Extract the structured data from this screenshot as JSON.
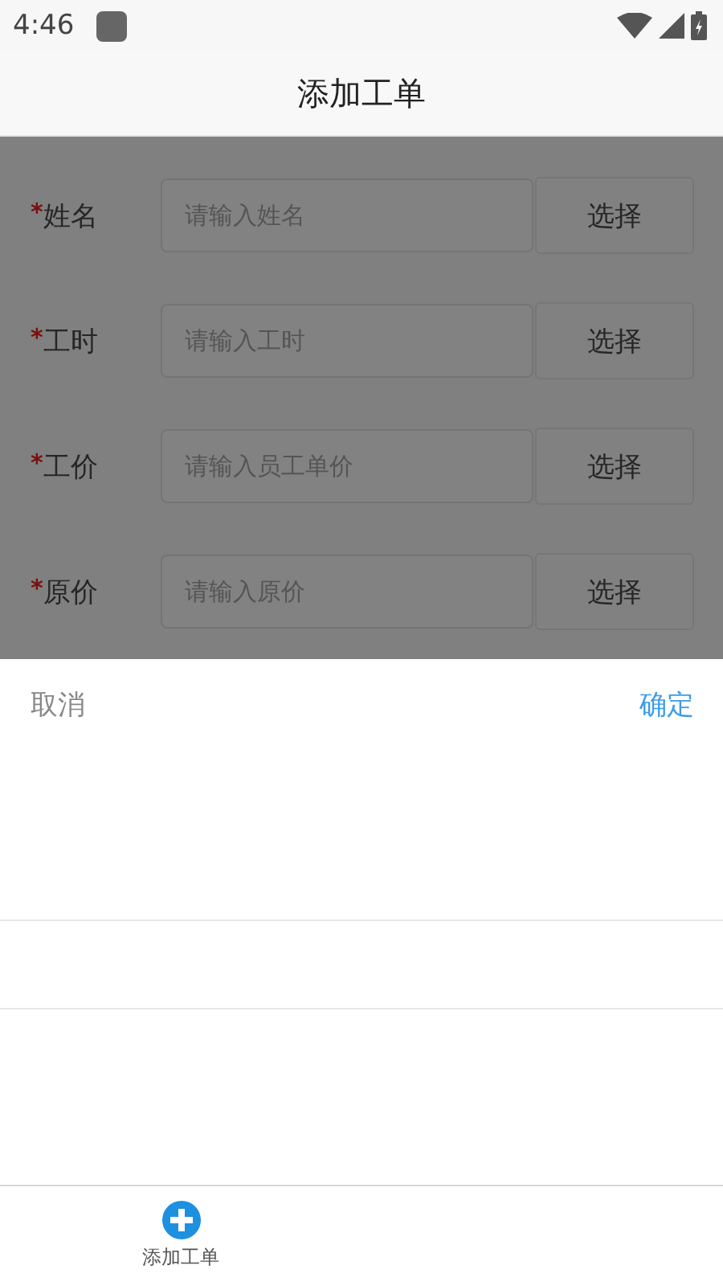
{
  "status_bar": {
    "time": "4:46"
  },
  "header": {
    "title": "添加工单"
  },
  "form": {
    "fields": [
      {
        "mark": "*",
        "label": "姓名",
        "placeholder": "请输入姓名",
        "button": "选择"
      },
      {
        "mark": "*",
        "label": "工时",
        "placeholder": "请输入工时",
        "button": "选择"
      },
      {
        "mark": "*",
        "label": "工价",
        "placeholder": "请输入员工单价",
        "button": "选择"
      },
      {
        "mark": "*",
        "label": "原价",
        "placeholder": "请输入原价",
        "button": "选择"
      }
    ]
  },
  "picker": {
    "cancel": "取消",
    "confirm": "确定"
  },
  "bottom_nav": {
    "items": [
      {
        "label": "添加工单"
      }
    ]
  }
}
